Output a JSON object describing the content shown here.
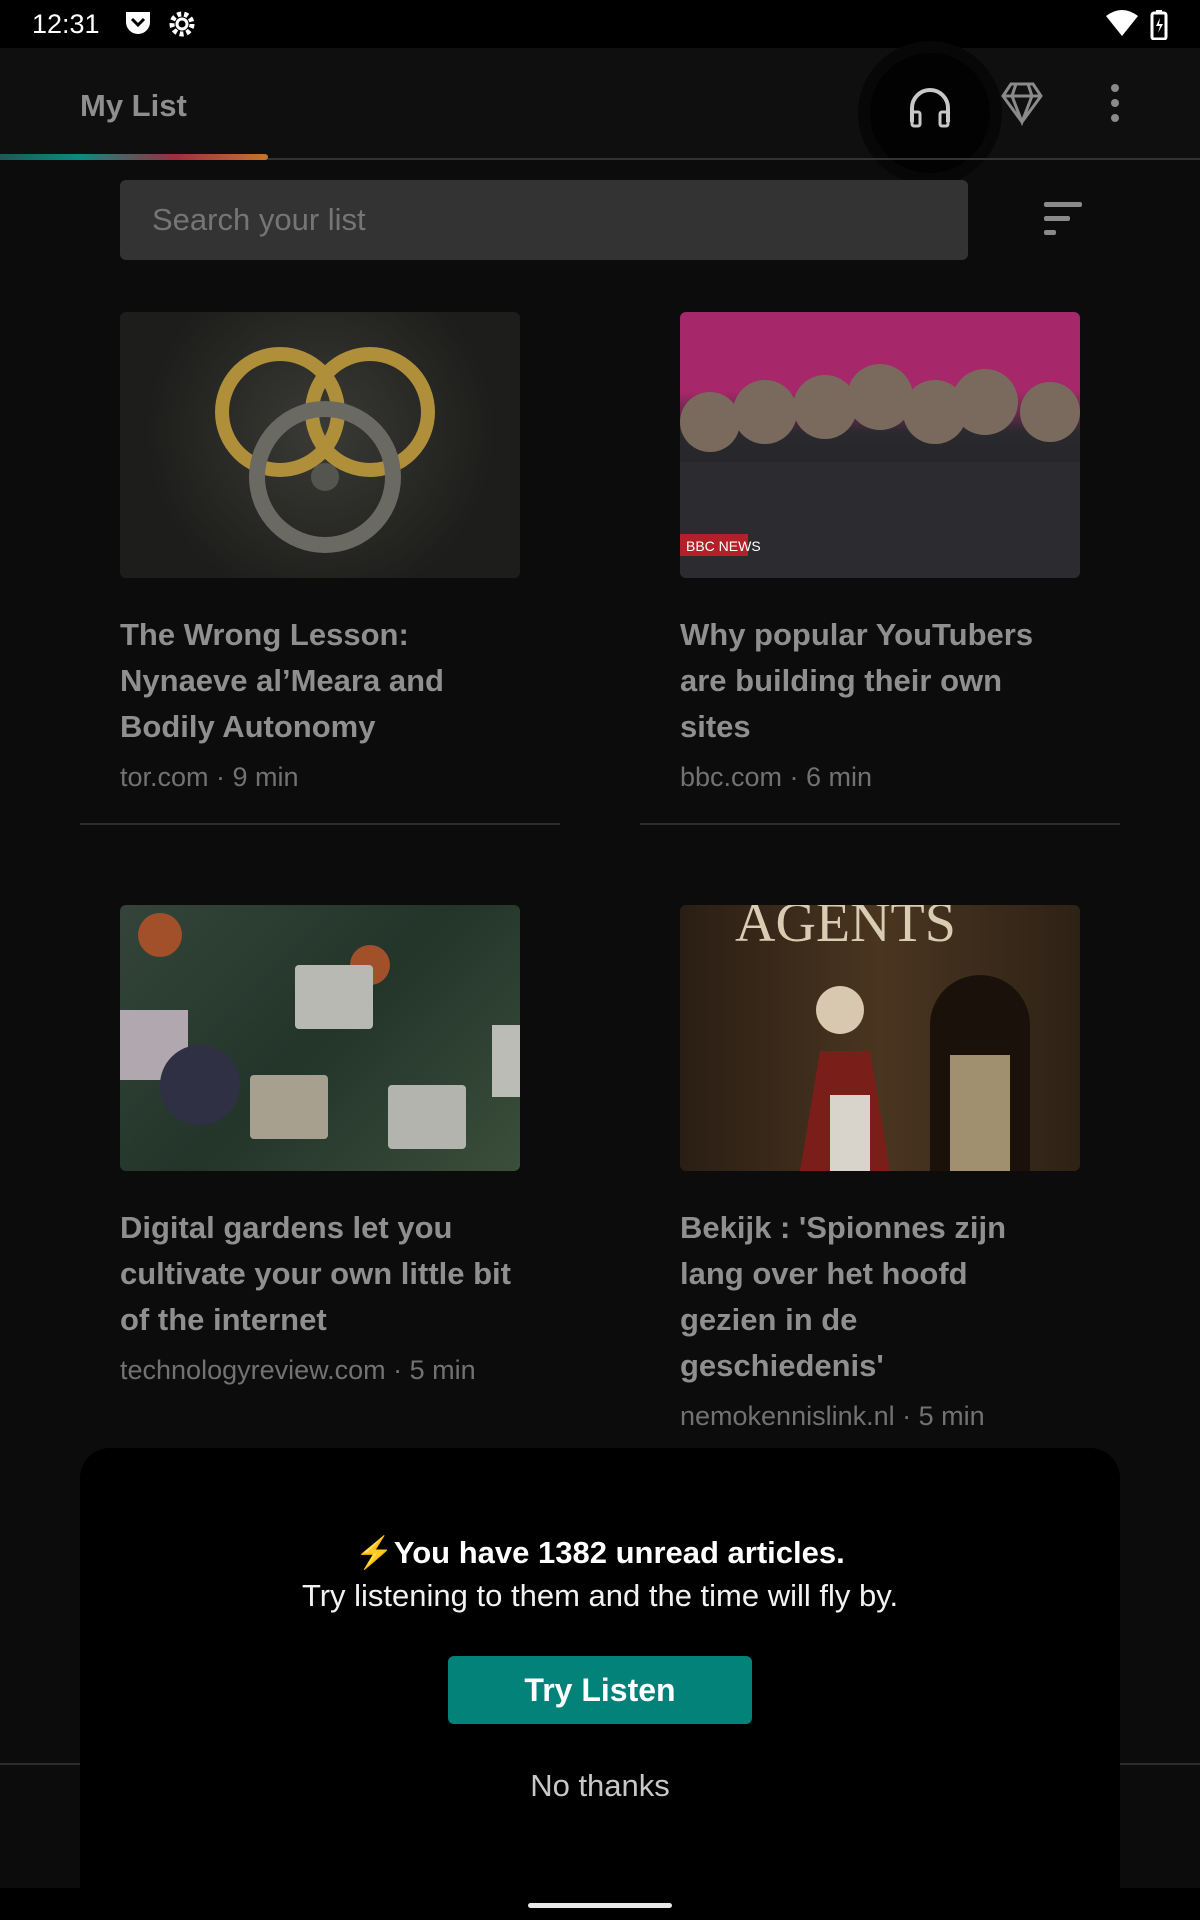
{
  "status_bar": {
    "time": "12:31",
    "icons": [
      "pocket-icon",
      "settings-icon",
      "wifi-icon",
      "battery-charging-icon"
    ]
  },
  "toolbar": {
    "title": "My List",
    "icons": [
      "headphones-icon",
      "diamond-icon",
      "more-vert-icon"
    ]
  },
  "search": {
    "placeholder": "Search your list"
  },
  "articles": [
    {
      "title": "The Wrong Lesson: Nynaeve al’Meara and Bodily Autonomy",
      "meta": "tor.com · 9 min"
    },
    {
      "title": "Why popular YouTubers are building their own sites",
      "meta": "bbc.com · 6 min",
      "image_text": "BBC NEWS"
    },
    {
      "title": "Digital gardens let you cultivate your own little bit of the internet",
      "meta": "technologyreview.com · 5 min"
    },
    {
      "title": "Bekijk : 'Spionnes zijn lang over het hoofd gezien in de geschiedenis'",
      "meta": "nemokennislink.nl · 5 min",
      "image_text": "AGENTS"
    }
  ],
  "sheet": {
    "headline": "You have 1382 unread articles.",
    "subtitle": "Try listening to them and the time will fly by.",
    "primary": "Try Listen",
    "secondary": "No thanks",
    "accent": "#03827a"
  }
}
